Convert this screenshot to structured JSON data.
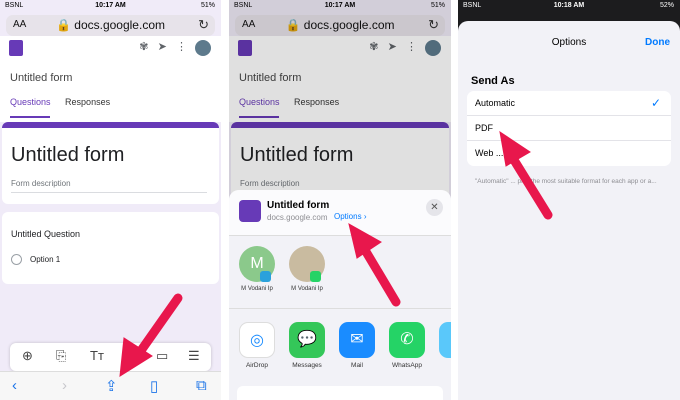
{
  "panel1": {
    "status": {
      "carrier": "BSNL",
      "time": "10:17 AM",
      "battery": "51%"
    },
    "urlbar": {
      "text_size": "AA",
      "url": "docs.google.com"
    },
    "form_title": "Untitled form",
    "tabs": [
      "Questions",
      "Responses"
    ],
    "title_card": {
      "title": "Untitled form",
      "description": "Form description"
    },
    "question_card": {
      "title": "Untitled Question",
      "option": "Option 1"
    },
    "form_tools_icons": [
      "add-question-icon",
      "import-icon",
      "title-text-icon",
      "video-icon",
      "section-icon"
    ],
    "title_tool_label": "Tт",
    "toolbar_icons": [
      "back-icon",
      "forward-icon",
      "share-icon",
      "bookmarks-icon",
      "tabs-icon"
    ]
  },
  "panel2": {
    "status": {
      "carrier": "BSNL",
      "time": "10:17 AM",
      "battery": "51%"
    },
    "urlbar": {
      "text_size": "AA",
      "url": "docs.google.com"
    },
    "form_title": "Untitled form",
    "tabs": [
      "Questions",
      "Responses"
    ],
    "title_card": {
      "title": "Untitled form",
      "description": "Form description"
    },
    "share_sheet": {
      "title": "Untitled form",
      "subtitle": "docs.google.com",
      "options": "Options",
      "options_chevron": "›",
      "close": "✕",
      "contacts": [
        {
          "name": "M Vodani Ip",
          "initial": "M"
        },
        {
          "name": "M Vodani Ip",
          "initial": ""
        }
      ],
      "apps": [
        {
          "name": "AirDrop",
          "glyph": "◎",
          "color": "#ffffff"
        },
        {
          "name": "Messages",
          "glyph": "💬",
          "color": "#34c759"
        },
        {
          "name": "Mail",
          "glyph": "✉",
          "color": "#1a8cff"
        },
        {
          "name": "WhatsApp",
          "glyph": "✆",
          "color": "#25d366"
        }
      ]
    }
  },
  "panel3": {
    "status": {
      "carrier": "BSNL",
      "time": "10:18 AM",
      "battery": "52%"
    },
    "sheet_title": "Options",
    "done": "Done",
    "section": "Send As",
    "rows": [
      {
        "label": "Automatic",
        "selected": true
      },
      {
        "label": "PDF",
        "selected": false
      },
      {
        "label": "Web ... ive",
        "selected": false
      }
    ],
    "footnote": "\"Automatic\" ... pick the most suitable format for each app or a..."
  },
  "colors": {
    "accent": "#673ab7",
    "ios_blue": "#007aff",
    "arrow": "#e8174c"
  }
}
